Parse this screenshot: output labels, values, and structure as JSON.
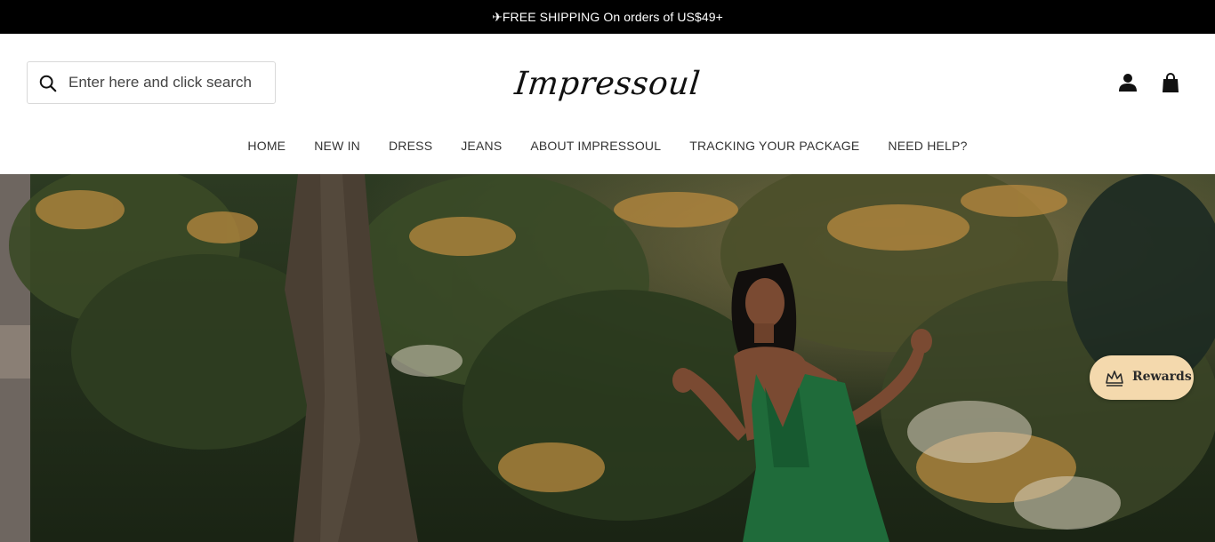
{
  "announcement": {
    "icon": "airplane-icon",
    "text": "✈FREE SHIPPING On orders of US$49+"
  },
  "search": {
    "placeholder": "Enter here and click search",
    "icon": "search-icon"
  },
  "brand": {
    "logo_text": "Impressoul"
  },
  "header_icons": {
    "account": "user-icon",
    "cart": "shopping-bag-icon"
  },
  "nav": {
    "items": [
      {
        "label": "HOME"
      },
      {
        "label": "NEW IN"
      },
      {
        "label": "DRESS"
      },
      {
        "label": "JEANS"
      },
      {
        "label": "ABOUT IMPRESSOUL"
      },
      {
        "label": "TRACKING YOUR PACKAGE"
      },
      {
        "label": "NEED HELP?"
      }
    ]
  },
  "rewards": {
    "label": "Rewards",
    "icon": "crown-icon"
  },
  "colors": {
    "announcement_bg": "#000000",
    "rewards_bg": "#f4d9ad",
    "dress_green": "#1f6b3a"
  }
}
